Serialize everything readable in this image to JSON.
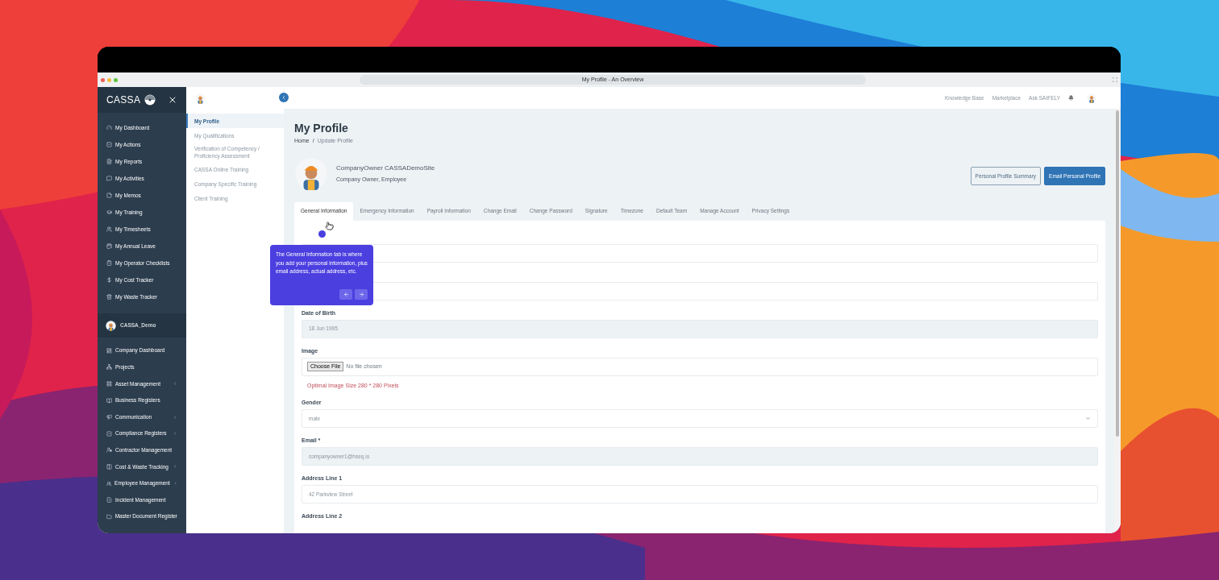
{
  "browser": {
    "title": "My Profile - An Overview"
  },
  "sidebar": {
    "brand": "CASSA",
    "items": [
      {
        "label": "My Dashboard"
      },
      {
        "label": "My Actions"
      },
      {
        "label": "My Reports"
      },
      {
        "label": "My Activities"
      },
      {
        "label": "My Memos"
      },
      {
        "label": "My Training"
      },
      {
        "label": "My Timesheets"
      },
      {
        "label": "My Annual Leave"
      },
      {
        "label": "My Operator Checklists"
      },
      {
        "label": "My Cost Tracker"
      },
      {
        "label": "My Waste Tracker"
      }
    ],
    "company": {
      "name": "CASSA_Demo"
    },
    "company_items": [
      {
        "label": "Company Dashboard",
        "expandable": false
      },
      {
        "label": "Projects",
        "expandable": false
      },
      {
        "label": "Asset Management",
        "expandable": true
      },
      {
        "label": "Business Registers",
        "expandable": false
      },
      {
        "label": "Communication",
        "expandable": true
      },
      {
        "label": "Compliance Registers",
        "expandable": true
      },
      {
        "label": "Contractor Management",
        "expandable": false
      },
      {
        "label": "Cost & Waste Tracking",
        "expandable": true
      },
      {
        "label": "Employee Management",
        "expandable": true
      },
      {
        "label": "Incident Management",
        "expandable": false
      },
      {
        "label": "Master Document Register",
        "expandable": false
      }
    ]
  },
  "submenu": [
    {
      "label": "My Profile",
      "selected": true
    },
    {
      "label": "My Qualifications",
      "selected": false
    },
    {
      "label": "Verification of Competency / Proficiency Assessment",
      "selected": false
    },
    {
      "label": "CASSA Online Training",
      "selected": false
    },
    {
      "label": "Company Specific Training",
      "selected": false
    },
    {
      "label": "Client Training",
      "selected": false
    }
  ],
  "top_nav": {
    "links": [
      "Knowledge Base",
      "Marketplace",
      "Ask SAIFELY"
    ]
  },
  "page": {
    "title": "My Profile",
    "breadcrumb": [
      "Home",
      "Update Profile"
    ],
    "separator": "/"
  },
  "profile": {
    "name": "CompanyOwner CASSADemoSite",
    "roles": "Company Owner, Employee"
  },
  "buttons": [
    {
      "label": "Personal Profile Summary",
      "kind": "outline"
    },
    {
      "label": "Email Personal Profile",
      "kind": "primary"
    }
  ],
  "tabs": [
    {
      "label": "General Information",
      "selected": true
    },
    {
      "label": "Emergency Information",
      "selected": false
    },
    {
      "label": "Payroll Information",
      "selected": false
    },
    {
      "label": "Change Email",
      "selected": false
    },
    {
      "label": "Change Password",
      "selected": false
    },
    {
      "label": "Signature",
      "selected": false
    },
    {
      "label": "Timezone",
      "selected": false
    },
    {
      "label": "Default Team",
      "selected": false
    },
    {
      "label": "Manage Account",
      "selected": false
    },
    {
      "label": "Privacy Settings",
      "selected": false
    }
  ],
  "form": [
    {
      "kind": "input",
      "disabled": false
    },
    {
      "kind": "input",
      "disabled": false
    },
    {
      "kind": "input",
      "label": "Date of Birth",
      "value": "18 Jun 1995",
      "disabled": true
    },
    {
      "kind": "file",
      "label": "Image",
      "button": "Choose File",
      "value": "No file chosen",
      "hint": "Optimal Image Size 280 * 280 Pixels"
    },
    {
      "kind": "select",
      "label": "Gender",
      "value": "male"
    },
    {
      "kind": "input",
      "label": "Email *",
      "value": "companyowner1@hseq.io",
      "disabled": true
    },
    {
      "kind": "input",
      "label": "Address Line 1",
      "value": "42 Parkview Street",
      "disabled": false
    },
    {
      "kind": "label",
      "label": "Address Line 2"
    }
  ],
  "tooltip": {
    "text": "The General Information tab is where you add your personal information, plus email address, actual address, etc."
  }
}
